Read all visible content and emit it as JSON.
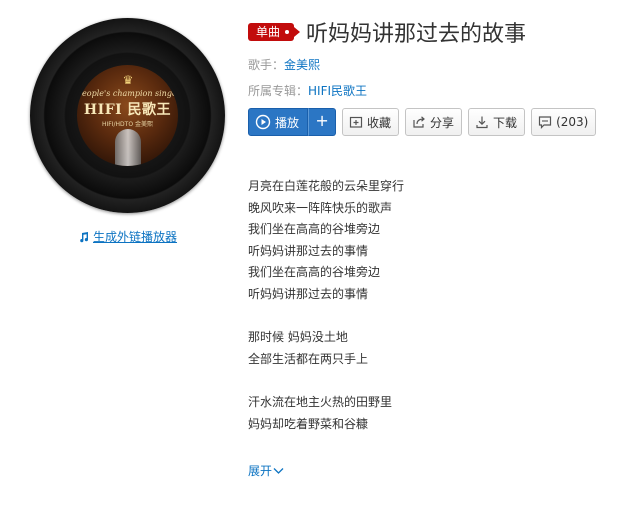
{
  "cover": {
    "subtitle": "People's champion singer",
    "title": "HIFI 民歌王",
    "artist_small": "HIFI/HDTO 金美熙"
  },
  "external_player_link": "生成外链播放器",
  "song": {
    "badge": "单曲",
    "title": "听妈妈讲那过去的故事",
    "singer_label": "歌手：",
    "singer": "金美熙",
    "album_label": "所属专辑：",
    "album": "HIFI民歌王"
  },
  "actions": {
    "play": "播放",
    "add": "+",
    "collect": "收藏",
    "share": "分享",
    "download": "下载",
    "comments": "(203)"
  },
  "lyrics": {
    "stanza1": [
      "月亮在白莲花般的云朵里穿行",
      "晚风吹来一阵阵快乐的歌声",
      "我们坐在高高的谷堆旁边",
      "听妈妈讲那过去的事情",
      "我们坐在高高的谷堆旁边",
      "听妈妈讲那过去的事情"
    ],
    "stanza2": [
      "那时候 妈妈没土地",
      "全部生活都在两只手上"
    ],
    "stanza3": [
      "汗水流在地主火热的田野里",
      "妈妈却吃着野菜和谷糠"
    ]
  },
  "expand_label": "展开",
  "colors": {
    "accent_blue": "#2b76c4",
    "link_blue": "#0c73c2",
    "badge_red": "#c20c0c"
  }
}
